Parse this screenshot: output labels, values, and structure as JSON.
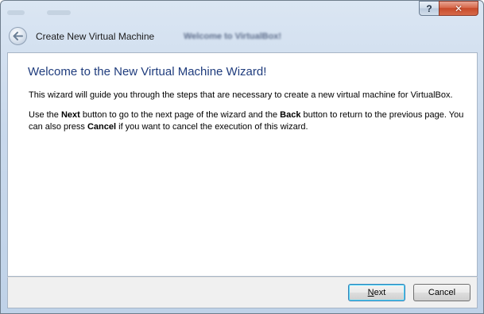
{
  "window": {
    "help_label": "?",
    "close_label": "✕"
  },
  "header": {
    "back_icon": "back-arrow-icon",
    "title": "Create New Virtual Machine",
    "background_title": "Welcome to VirtualBox!"
  },
  "content": {
    "heading": "Welcome to the New Virtual Machine Wizard!",
    "p1": "This wizard will guide you through the steps that are necessary to create a new virtual machine for VirtualBox.",
    "p2": {
      "t1": "Use the ",
      "b1": "Next",
      "t2": " button to go to the next page of the wizard and the ",
      "b2": "Back",
      "t3": " button to return to the previous page. You can also press ",
      "b3": "Cancel",
      "t4": " if you want to cancel the execution of this wizard."
    }
  },
  "footer": {
    "next_mnemonic": "N",
    "next_rest": "ext",
    "cancel_label": "Cancel"
  },
  "colors": {
    "heading": "#1f3c7d",
    "titlebar": "#c9d9ec",
    "close": "#c74a2a"
  }
}
